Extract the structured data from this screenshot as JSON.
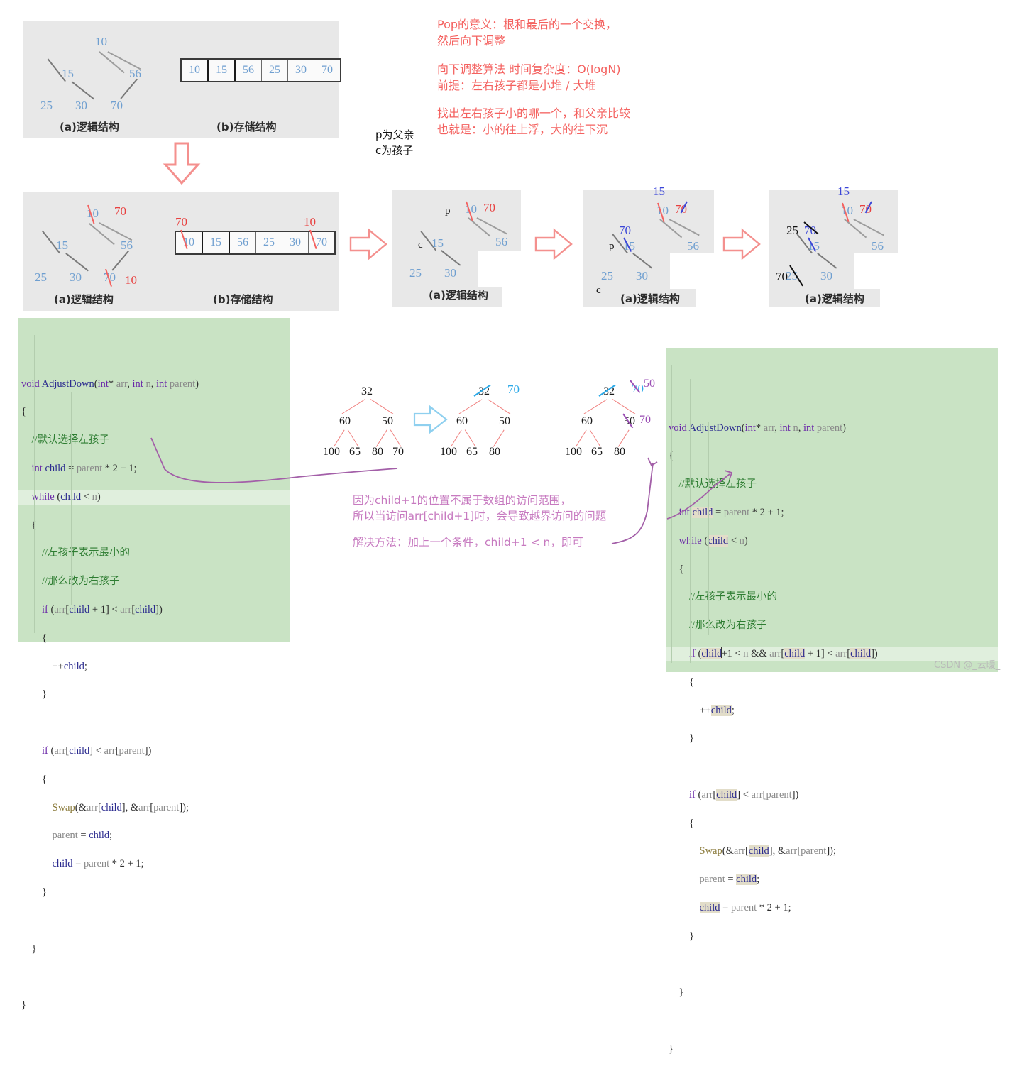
{
  "meta": {
    "watermark": "CSDN @_云暖_"
  },
  "notes": {
    "pop_meaning": "Pop的意义：根和最后的一个交换，\n然后向下调整",
    "complexity": "向下调整算法 时间复杂度：O(logN)\n前提：左右孩子都是小堆 / 大堆",
    "compare_rule": "找出左右孩子小的哪一个，和父亲比较\n也就是：小的往上浮，大的往下沉",
    "pc_legend": "p为父亲\nc为孩子",
    "oob_reason": "因为child+1的位置不属于数组的访问范围，\n所以当访问arr[child+1]时，会导致越界访问的问题",
    "oob_fix": "解决方法：加上一个条件，child+1 < n，即可"
  },
  "figures": {
    "fig1": {
      "caption_a": "(a)逻辑结构",
      "caption_b": "(b)存储结构",
      "tree": {
        "root": "10",
        "l": "15",
        "r": "56",
        "ll": "25",
        "lr": "30",
        "rl": "70"
      },
      "array": [
        "10",
        "15",
        "56",
        "25",
        "30",
        "70"
      ]
    },
    "fig2": {
      "caption_a": "(a)逻辑结构",
      "caption_b": "(b)存储结构",
      "tree": {
        "root": "10",
        "l": "15",
        "r": "56",
        "ll": "25",
        "lr": "30",
        "rl": "70"
      },
      "array": [
        "10",
        "15",
        "56",
        "25",
        "30",
        "70"
      ],
      "ann_root": "70",
      "ann_leaf": "10",
      "ann_arr_first": "70",
      "ann_arr_last": "10"
    },
    "fig3": {
      "caption_a": "(a)逻辑结构",
      "tree": {
        "root": "10",
        "l": "15",
        "r": "56",
        "ll": "25",
        "lr": "30"
      },
      "ann_root": "70",
      "label_p": "p",
      "label_c": "c"
    },
    "fig4": {
      "caption_a": "(a)逻辑结构",
      "tree": {
        "root": "10",
        "l": "15",
        "r": "56",
        "ll": "25",
        "lr": "30"
      },
      "ann_root_red": "70",
      "ann_top_blue": "15",
      "ann_left_blue": "70",
      "label_p": "p",
      "label_c": "c"
    },
    "fig5": {
      "caption_a": "(a)逻辑结构",
      "tree": {
        "root": "10",
        "l": "15",
        "r": "56",
        "ll": "25",
        "lr": "30"
      },
      "ann_root_red": "70",
      "ann_top_blue": "15",
      "ann_left_blue": "70",
      "ann_left_black": "25",
      "ann_leaf_black": "70"
    },
    "small1": {
      "nodes": {
        "root": "32",
        "l": "60",
        "r": "50",
        "ll": "100",
        "lr": "65",
        "rl": "80",
        "rr": "70"
      }
    },
    "small2": {
      "nodes": {
        "root": "32",
        "l": "60",
        "r": "50",
        "ll": "100",
        "lr": "65",
        "rl": "80"
      },
      "ann_root": "70"
    },
    "small3": {
      "nodes": {
        "root": "32",
        "l": "60",
        "r": "50",
        "ll": "100",
        "lr": "65",
        "rl": "80"
      },
      "ann_root_blue": "70",
      "ann_root_purple": "50",
      "ann_right_purple": "70"
    }
  },
  "code_left": {
    "lines": [
      "void AdjustDown(int* arr, int n, int parent)",
      "{",
      "    //默认选择左孩子",
      "    int child = parent * 2 + 1;",
      "    while (child < n)",
      "    {",
      "        //左孩子表示最小的",
      "        //那么改为右孩子",
      "        if (arr[child + 1] < arr[child])",
      "        {",
      "            ++child;",
      "        }",
      "",
      "        if (arr[child] < arr[parent])",
      "        {",
      "            Swap(&arr[child], &arr[parent]);",
      "            parent = child;",
      "            child = parent * 2 + 1;",
      "        }",
      "",
      "    }",
      "",
      "}"
    ],
    "highlighted_line_index": 4
  },
  "code_right": {
    "lines": [
      "void AdjustDown(int* arr, int n, int parent)",
      "{",
      "    //默认选择左孩子",
      "    int child = parent * 2 + 1;",
      "    while (child < n)",
      "    {",
      "        //左孩子表示最小的",
      "        //那么改为右孩子",
      "        if (child+1 < n && arr[child + 1] < arr[child])",
      "        {",
      "            ++child;",
      "        }",
      "",
      "        if (arr[child] < arr[parent])",
      "        {",
      "            Swap(&arr[child], &arr[parent]);",
      "            parent = child;",
      "            child = parent * 2 + 1;",
      "        }",
      "",
      "    }",
      "",
      "}"
    ],
    "highlighted_line_index": 8
  },
  "colors": {
    "code_bg": "#c9e3c4",
    "panel_bg": "#e8e8e8",
    "node_blue": "#6f9fd0",
    "red_ink": "#f4615f",
    "blue_ink": "#3b46d8",
    "cyan_ink": "#2ba9e8",
    "purple_ink": "#9b4fb5",
    "pink_ink": "#c77ac0"
  }
}
